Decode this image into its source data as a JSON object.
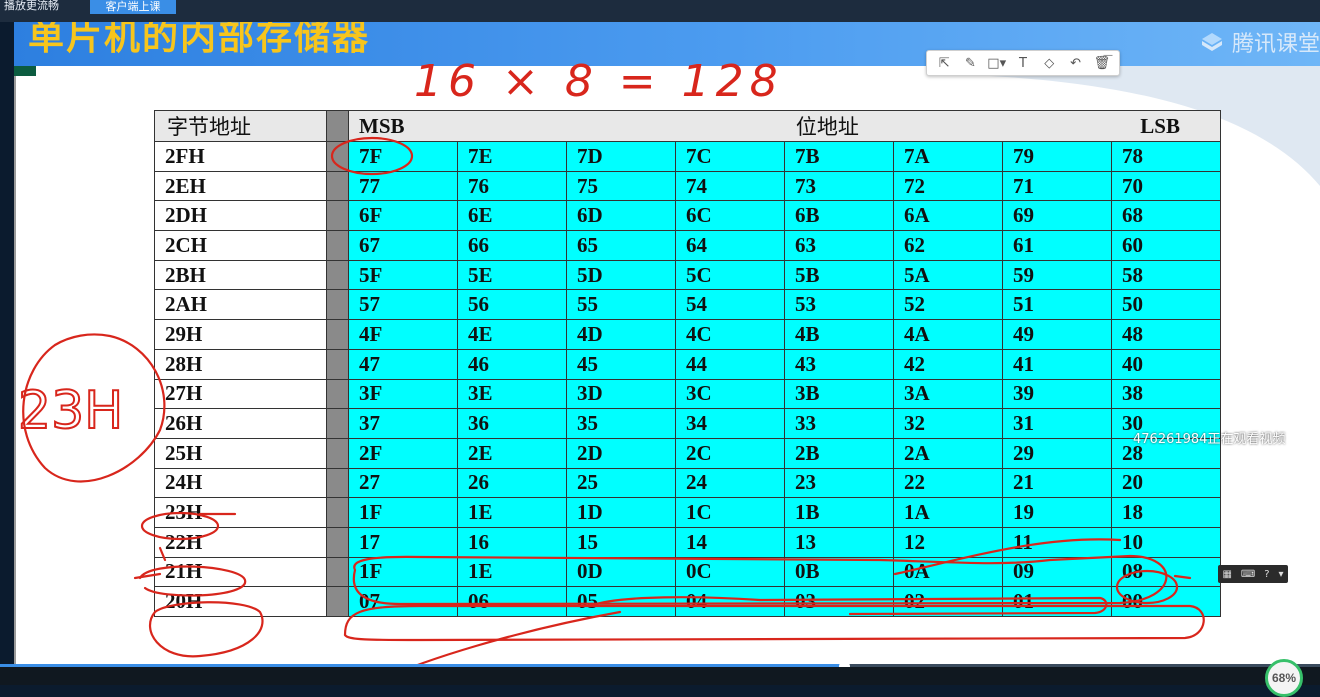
{
  "topbar": {
    "left_label": "播放更流畅",
    "active_tab": "客户端上课"
  },
  "slide": {
    "title": "单片机的内部存储器",
    "brand": "腾讯课堂",
    "formula": "16 × 8 = 128",
    "annotation_circle": "23H"
  },
  "toolbar": {
    "tools": [
      "select-icon",
      "pen-icon",
      "rect-icon",
      "text-icon",
      "eraser-icon",
      "undo-icon",
      "trash-icon"
    ],
    "tool_glyphs": [
      "⇱",
      "✎",
      "□▾",
      "T",
      "◇",
      "↶",
      "🗑"
    ]
  },
  "table": {
    "header": {
      "byte_addr": "字节地址",
      "msb": "MSB",
      "bit_addr": "位地址",
      "lsb": "LSB"
    },
    "rows": [
      {
        "addr": "2FH",
        "bits": [
          "7F",
          "7E",
          "7D",
          "7C",
          "7B",
          "7A",
          "79",
          "78"
        ]
      },
      {
        "addr": "2EH",
        "bits": [
          "77",
          "76",
          "75",
          "74",
          "73",
          "72",
          "71",
          "70"
        ]
      },
      {
        "addr": "2DH",
        "bits": [
          "6F",
          "6E",
          "6D",
          "6C",
          "6B",
          "6A",
          "69",
          "68"
        ]
      },
      {
        "addr": "2CH",
        "bits": [
          "67",
          "66",
          "65",
          "64",
          "63",
          "62",
          "61",
          "60"
        ]
      },
      {
        "addr": "2BH",
        "bits": [
          "5F",
          "5E",
          "5D",
          "5C",
          "5B",
          "5A",
          "59",
          "58"
        ]
      },
      {
        "addr": "2AH",
        "bits": [
          "57",
          "56",
          "55",
          "54",
          "53",
          "52",
          "51",
          "50"
        ]
      },
      {
        "addr": "29H",
        "bits": [
          "4F",
          "4E",
          "4D",
          "4C",
          "4B",
          "4A",
          "49",
          "48"
        ]
      },
      {
        "addr": "28H",
        "bits": [
          "47",
          "46",
          "45",
          "44",
          "43",
          "42",
          "41",
          "40"
        ]
      },
      {
        "addr": "27H",
        "bits": [
          "3F",
          "3E",
          "3D",
          "3C",
          "3B",
          "3A",
          "39",
          "38"
        ]
      },
      {
        "addr": "26H",
        "bits": [
          "37",
          "36",
          "35",
          "34",
          "33",
          "32",
          "31",
          "30"
        ]
      },
      {
        "addr": "25H",
        "bits": [
          "2F",
          "2E",
          "2D",
          "2C",
          "2B",
          "2A",
          "29",
          "28"
        ]
      },
      {
        "addr": "24H",
        "bits": [
          "27",
          "26",
          "25",
          "24",
          "23",
          "22",
          "21",
          "20"
        ]
      },
      {
        "addr": "23H",
        "bits": [
          "1F",
          "1E",
          "1D",
          "1C",
          "1B",
          "1A",
          "19",
          "18"
        ]
      },
      {
        "addr": "22H",
        "bits": [
          "17",
          "16",
          "15",
          "14",
          "13",
          "12",
          "11",
          "10"
        ]
      },
      {
        "addr": "21H",
        "bits": [
          "1F",
          "1E",
          "0D",
          "0C",
          "0B",
          "0A",
          "09",
          "08"
        ]
      },
      {
        "addr": "20H",
        "bits": [
          "07",
          "06",
          "05",
          "04",
          "03",
          "02",
          "01",
          "00"
        ]
      }
    ]
  },
  "overlay": {
    "watermark": "476261984正在观看视频"
  },
  "player": {
    "progress": 0.64,
    "zoom": "68%",
    "mini_tools": [
      "grid-icon",
      "keyboard-icon",
      "help-icon",
      "dropdown-icon"
    ],
    "mini_glyphs": [
      "▦",
      "⌨",
      "?",
      "▾"
    ]
  },
  "colors": {
    "ink": "#d8261c",
    "cell": "#00ffff",
    "title": "#f7c51c",
    "banner": "#3b8de6"
  }
}
